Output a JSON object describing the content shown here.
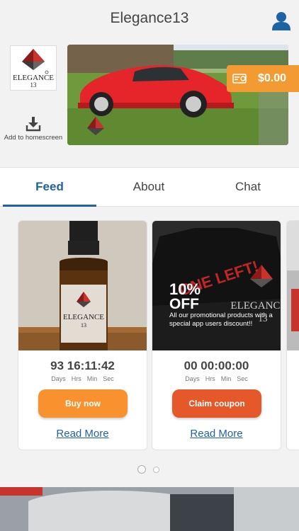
{
  "header": {
    "title": "Elegance13"
  },
  "brand": {
    "logo_name": "ELEGANCE",
    "logo_number": "13"
  },
  "add_homescreen": {
    "label": "Add to homescreen"
  },
  "balance": {
    "amount": "$0.00"
  },
  "tabs": [
    {
      "label": "Feed",
      "active": true
    },
    {
      "label": "About",
      "active": false
    },
    {
      "label": "Chat",
      "active": false
    }
  ],
  "cards": [
    {
      "product_label": "ELEGANCE",
      "product_number": "13",
      "timer": "93 16:11:42",
      "timer_labels": [
        "Days",
        "Hrs",
        "Min",
        "Sec"
      ],
      "button_label": "Buy now",
      "button_color": "#f7922f",
      "read_more": "Read More"
    },
    {
      "promo_big": "10%",
      "promo_off": "OFF",
      "promo_banner": "ONE LEFT!",
      "promo_text": "All our promotional products with a special app users discount!!",
      "shirt_label": "ELEGANCE",
      "shirt_number": "13",
      "timer": "00 00:00:00",
      "timer_labels": [
        "Days",
        "Hrs",
        "Min",
        "Sec"
      ],
      "button_label": "Claim coupon",
      "button_color": "#e4582a",
      "read_more": "Read More"
    }
  ],
  "pager": {
    "pages": 2,
    "current": 1
  },
  "colors": {
    "accent": "#1e63a4",
    "balance": "#f39b32"
  }
}
